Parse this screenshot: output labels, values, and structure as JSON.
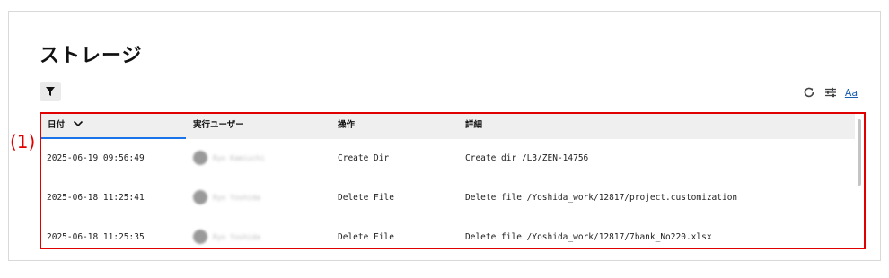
{
  "page": {
    "title": "ストレージ",
    "callout": "(1)"
  },
  "toolbar": {
    "filter_icon": "filter-icon",
    "refresh_icon": "refresh-icon",
    "settings_icon": "column-settings-icon",
    "font_label": "Aa"
  },
  "table": {
    "columns": [
      {
        "label": "日付",
        "sorted": true,
        "sort_icon": "chevron-down-icon"
      },
      {
        "label": "実行ユーザー"
      },
      {
        "label": "操作"
      },
      {
        "label": "詳細"
      }
    ],
    "rows": [
      {
        "date": "2025-06-19 09:56:49",
        "user": "Ryo Kamiuchi",
        "action": "Create Dir",
        "detail": "Create dir /L3/ZEN-14756"
      },
      {
        "date": "2025-06-18 11:25:41",
        "user": "Ryo Yoshida",
        "action": "Delete File",
        "detail": "Delete file /Yoshida_work/12817/project.customization"
      },
      {
        "date": "2025-06-18 11:25:35",
        "user": "Ryo Yoshida",
        "action": "Delete File",
        "detail": "Delete file /Yoshida_work/12817/7bank_No220.xlsx"
      }
    ]
  },
  "colors": {
    "accent": "#1a73e8",
    "highlight": "#e00000"
  }
}
